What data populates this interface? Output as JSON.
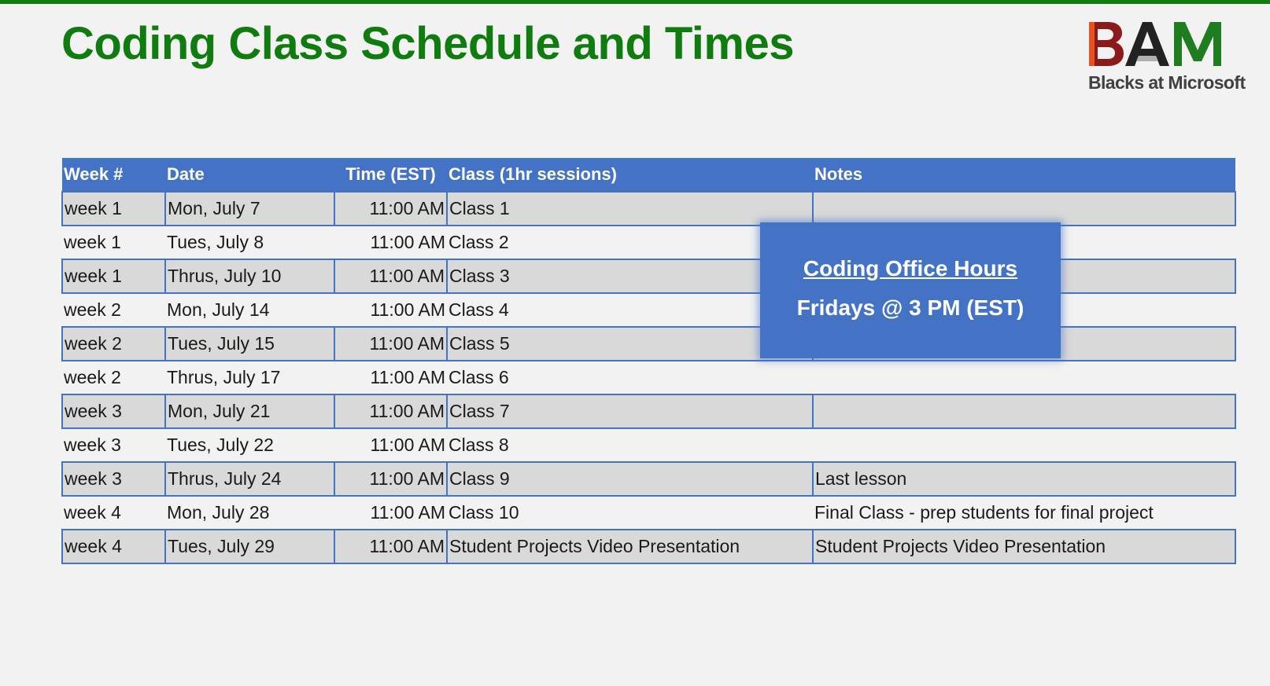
{
  "title": "Coding Class Schedule and Times",
  "logo": {
    "letters": "BAM",
    "subtitle": "Blacks at Microsoft",
    "colors": {
      "B": "#8b1a1a",
      "A": "#222222",
      "M": "#1e7d1e",
      "accent": "#e8501c"
    }
  },
  "colors": {
    "title": "#107c10",
    "header_bg": "#4472c4",
    "row_shade": "#d9d9d9",
    "background": "#f2f2f2"
  },
  "table": {
    "headers": [
      "Week #",
      "Date",
      "Time (EST)",
      "Class (1hr sessions)",
      "Notes"
    ],
    "rows": [
      {
        "week": "week 1",
        "date": "Mon, July 7",
        "time": "11:00 AM",
        "class": "Class 1",
        "notes": ""
      },
      {
        "week": "week 1",
        "date": "Tues, July 8",
        "time": "11:00 AM",
        "class": "Class 2",
        "notes": ""
      },
      {
        "week": "week 1",
        "date": "Thrus, July 10",
        "time": "11:00 AM",
        "class": "Class 3",
        "notes": ""
      },
      {
        "week": "week 2",
        "date": "Mon, July 14",
        "time": "11:00 AM",
        "class": "Class 4",
        "notes": ""
      },
      {
        "week": "week 2",
        "date": "Tues, July 15",
        "time": "11:00 AM",
        "class": "Class 5",
        "notes": ""
      },
      {
        "week": "week 2",
        "date": "Thrus, July 17",
        "time": "11:00 AM",
        "class": "Class 6",
        "notes": ""
      },
      {
        "week": "week 3",
        "date": "Mon, July 21",
        "time": "11:00 AM",
        "class": "Class 7",
        "notes": ""
      },
      {
        "week": "week 3",
        "date": "Tues, July 22",
        "time": "11:00 AM",
        "class": "Class 8",
        "notes": ""
      },
      {
        "week": "week 3",
        "date": "Thrus, July 24",
        "time": "11:00 AM",
        "class": "Class 9",
        "notes": "Last lesson"
      },
      {
        "week": "week 4",
        "date": "Mon, July 28",
        "time": "11:00 AM",
        "class": "Class 10",
        "notes": "Final Class - prep students for final project"
      },
      {
        "week": "week 4",
        "date": "Tues, July 29",
        "time": "11:00 AM",
        "class": "Student Projects Video Presentation",
        "notes": "Student Projects Video Presentation"
      }
    ]
  },
  "office_hours": {
    "title": "Coding Office Hours",
    "time": "Fridays @ 3 PM (EST)"
  }
}
